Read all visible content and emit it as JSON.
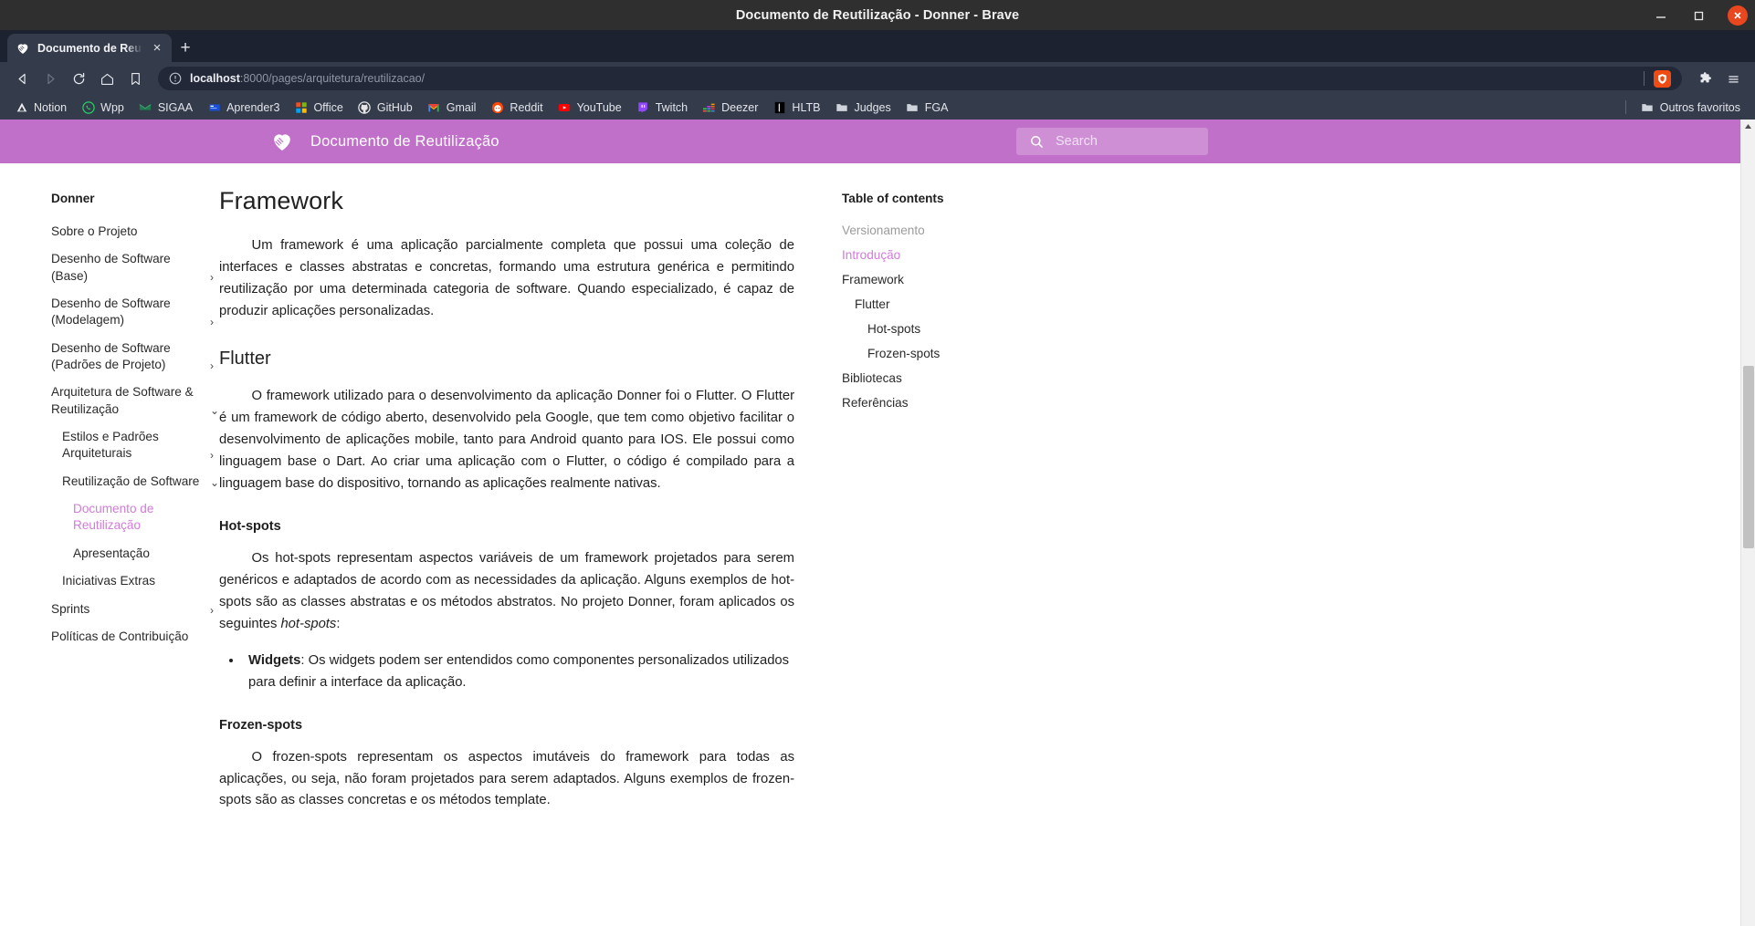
{
  "window": {
    "title": "Documento de Reutilização - Donner - Brave",
    "minimize_label": "Minimizar",
    "maximize_label": "Restaurar",
    "close_label": "Fechar"
  },
  "tabs": [
    {
      "title": "Documento de Reutilizaçã",
      "close_label": "×"
    }
  ],
  "tabstrip": {
    "new_tab_label": "+"
  },
  "toolbar": {
    "back_label": "◁",
    "forward_label": "▷",
    "reload_label": "⟳",
    "home_label": "⌂",
    "bookmark_label": "🔖",
    "url_host": "localhost",
    "url_rest": ":8000/pages/arquitetura/reutilizacao/",
    "url_full": "localhost:8000/pages/arquitetura/reutilizacao/"
  },
  "bookmarks": {
    "items": [
      {
        "label": "Notion",
        "icon": "notion-icon"
      },
      {
        "label": "Wpp",
        "icon": "whatsapp-icon"
      },
      {
        "label": "SIGAA",
        "icon": "sigaa-icon"
      },
      {
        "label": "Aprender3",
        "icon": "aprender3-icon"
      },
      {
        "label": "Office",
        "icon": "office-icon"
      },
      {
        "label": "GitHub",
        "icon": "github-icon"
      },
      {
        "label": "Gmail",
        "icon": "gmail-icon"
      },
      {
        "label": "Reddit",
        "icon": "reddit-icon"
      },
      {
        "label": "YouTube",
        "icon": "youtube-icon"
      },
      {
        "label": "Twitch",
        "icon": "twitch-icon"
      },
      {
        "label": "Deezer",
        "icon": "deezer-icon"
      },
      {
        "label": "HLTB",
        "icon": "hltb-icon"
      },
      {
        "label": "Judges",
        "icon": "folder-icon"
      },
      {
        "label": "FGA",
        "icon": "folder-icon"
      }
    ],
    "other": {
      "label": "Outros favoritos",
      "icon": "folder-icon"
    }
  },
  "site": {
    "header": {
      "title": "Documento de Reutilização",
      "logo": "handshake-heart-logo",
      "accent_color": "#c070c9"
    },
    "search": {
      "placeholder": "Search",
      "value": "",
      "icon": "search-icon"
    }
  },
  "sidebar": {
    "root": "Donner",
    "items": [
      {
        "label": "Sobre o Projeto",
        "level": 1,
        "chevron": "",
        "active": false
      },
      {
        "label": "Desenho de Software (Base)",
        "level": 1,
        "chevron": "›",
        "active": false
      },
      {
        "label": "Desenho de Software (Modelagem)",
        "level": 1,
        "chevron": "›",
        "active": false
      },
      {
        "label": "Desenho de Software (Padrões de Projeto)",
        "level": 1,
        "chevron": "›",
        "active": false
      },
      {
        "label": "Arquitetura de Software & Reutilização",
        "level": 1,
        "chevron": "⌄",
        "active": false
      },
      {
        "label": "Estilos e Padrões Arquiteturais",
        "level": 2,
        "chevron": "›",
        "active": false
      },
      {
        "label": "Reutilização de Software",
        "level": 2,
        "chevron": "⌄",
        "active": false
      },
      {
        "label": "Documento de Reutilização",
        "level": 3,
        "chevron": "",
        "active": true
      },
      {
        "label": "Apresentação",
        "level": 3,
        "chevron": "",
        "active": false
      },
      {
        "label": "Iniciativas Extras",
        "level": 2,
        "chevron": "",
        "active": false
      },
      {
        "label": "Sprints",
        "level": 1,
        "chevron": "›",
        "active": false
      },
      {
        "label": "Políticas de Contribuição",
        "level": 1,
        "chevron": "",
        "active": false
      }
    ]
  },
  "content": {
    "h1": "Framework",
    "p1": "Um framework é uma aplicação parcialmente completa que possui uma coleção de interfaces e classes abstratas e concretas, formando uma estrutura genérica e permitindo reutilização por uma determinada categoria de software. Quando especializado, é capaz de produzir aplicações personalizadas.",
    "h2_flutter": "Flutter",
    "p2": "O framework utilizado para o desenvolvimento da aplicação Donner foi o Flutter. O Flutter é um framework de código aberto, desenvolvido pela Google, que tem como objetivo facilitar o desenvolvimento de aplicações mobile, tanto para Android quanto para IOS. Ele possui como linguagem base o Dart. Ao criar uma aplicação com o Flutter, o código é compilado para a linguagem base do dispositivo, tornando as aplicações realmente nativas.",
    "h3_hotspots": "Hot-spots",
    "p3_a": "Os hot-spots representam aspectos variáveis de um framework projetados para serem genéricos e adaptados de acordo com as necessidades da aplicação. Alguns exemplos de hot-spots são as classes abstratas e os métodos abstratos. No projeto Donner, foram aplicados os seguintes ",
    "p3_em": "hot-spots",
    "p3_b": ":",
    "bullet1_strong": "Widgets",
    "bullet1_text": ": Os widgets podem ser entendidos como componentes personalizados utilizados para definir a interface da aplicação.",
    "h3_frozenspots": "Frozen-spots",
    "p4": "O frozen-spots representam os aspectos imutáveis do framework para todas as aplicações, ou seja, não foram projetados para serem adaptados. Alguns exemplos de frozen-spots são as classes concretas e os métodos template."
  },
  "toc": {
    "title": "Table of contents",
    "items": [
      {
        "label": "Versionamento",
        "indent": 0,
        "state": "muted"
      },
      {
        "label": "Introdução",
        "indent": 0,
        "state": "active"
      },
      {
        "label": "Framework",
        "indent": 0,
        "state": "normal"
      },
      {
        "label": "Flutter",
        "indent": 1,
        "state": "normal"
      },
      {
        "label": "Hot-spots",
        "indent": 2,
        "state": "normal"
      },
      {
        "label": "Frozen-spots",
        "indent": 2,
        "state": "normal"
      },
      {
        "label": "Bibliotecas",
        "indent": 0,
        "state": "normal"
      },
      {
        "label": "Referências",
        "indent": 0,
        "state": "normal"
      }
    ]
  }
}
